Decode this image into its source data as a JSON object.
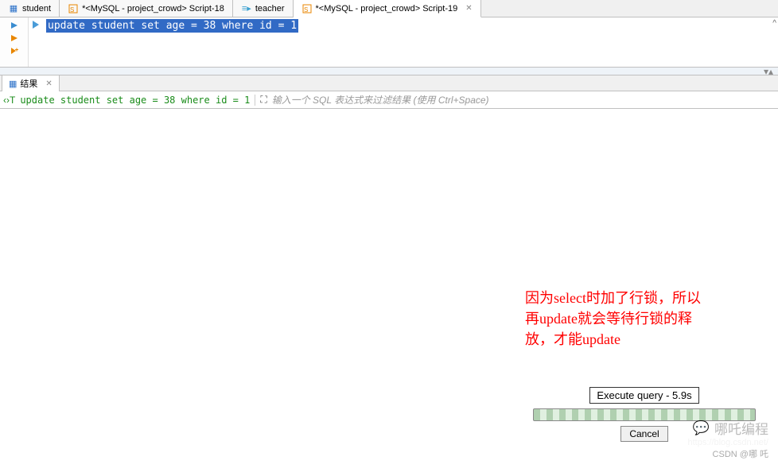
{
  "tabs": [
    {
      "label": "student"
    },
    {
      "label": "*<MySQL - project_crowd> Script-18"
    },
    {
      "label": "teacher"
    },
    {
      "label": "*<MySQL - project_crowd> Script-19"
    }
  ],
  "active_tab_close": "✕",
  "editor": {
    "sql": "update student set age = 38 where id = 1"
  },
  "results_tab": {
    "label": "结果",
    "close": "✕"
  },
  "filter_bar": {
    "sql_display": "update student set age = 38 where id = 1",
    "placeholder": "输入一个 SQL 表达式来过滤结果 (使用 Ctrl+Space)"
  },
  "annotation": {
    "line1": "因为select时加了行锁，所以",
    "line2": "再update就会等待行锁的释",
    "line3": "放，才能update"
  },
  "progress": {
    "label": "Execute query - 5.9s",
    "cancel": "Cancel"
  },
  "watermark": {
    "brand": "哪吒编程",
    "attr": "CSDN @哪 吒"
  }
}
